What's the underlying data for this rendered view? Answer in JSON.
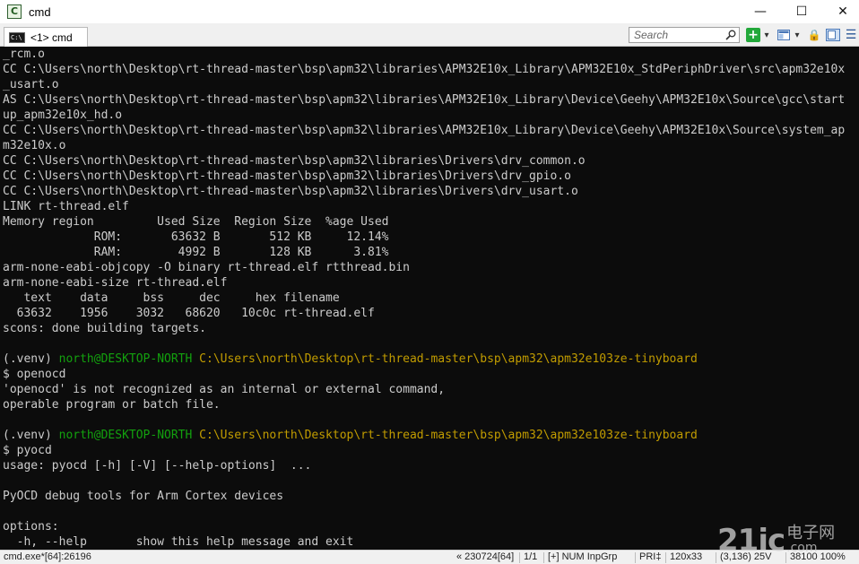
{
  "window": {
    "title": "cmd",
    "app_icon_glyph": "C",
    "minimize_glyph": "—",
    "maximize_glyph": "☐",
    "close_glyph": "✕"
  },
  "toolbar": {
    "tab_label": "<1>  cmd",
    "search_placeholder": "Search",
    "new_console_glyph": "+",
    "dropdown_glyph": "▾",
    "lock_glyph": "🔒",
    "menu_glyph": "☰"
  },
  "colors": {
    "console_bg": "#0c0c0c",
    "console_text": "#cccccc",
    "prompt_green": "#13a10e",
    "prompt_yellow": "#c19c00",
    "new_console_green": "#22a83a",
    "lock_yellow": "#d9a400"
  },
  "console": {
    "lines": [
      {
        "segments": [
          {
            "text": "_rcm.o",
            "color": "default"
          }
        ]
      },
      {
        "segments": [
          {
            "text": "CC C:\\Users\\north\\Desktop\\rt-thread-master\\bsp\\apm32\\libraries\\APM32E10x_Library\\APM32E10x_StdPeriphDriver\\src\\apm32e10x",
            "color": "default"
          }
        ]
      },
      {
        "segments": [
          {
            "text": "_usart.o",
            "color": "default"
          }
        ]
      },
      {
        "segments": [
          {
            "text": "AS C:\\Users\\north\\Desktop\\rt-thread-master\\bsp\\apm32\\libraries\\APM32E10x_Library\\Device\\Geehy\\APM32E10x\\Source\\gcc\\start",
            "color": "default"
          }
        ]
      },
      {
        "segments": [
          {
            "text": "up_apm32e10x_hd.o",
            "color": "default"
          }
        ]
      },
      {
        "segments": [
          {
            "text": "CC C:\\Users\\north\\Desktop\\rt-thread-master\\bsp\\apm32\\libraries\\APM32E10x_Library\\Device\\Geehy\\APM32E10x\\Source\\system_ap",
            "color": "default"
          }
        ]
      },
      {
        "segments": [
          {
            "text": "m32e10x.o",
            "color": "default"
          }
        ]
      },
      {
        "segments": [
          {
            "text": "CC C:\\Users\\north\\Desktop\\rt-thread-master\\bsp\\apm32\\libraries\\Drivers\\drv_common.o",
            "color": "default"
          }
        ]
      },
      {
        "segments": [
          {
            "text": "CC C:\\Users\\north\\Desktop\\rt-thread-master\\bsp\\apm32\\libraries\\Drivers\\drv_gpio.o",
            "color": "default"
          }
        ]
      },
      {
        "segments": [
          {
            "text": "CC C:\\Users\\north\\Desktop\\rt-thread-master\\bsp\\apm32\\libraries\\Drivers\\drv_usart.o",
            "color": "default"
          }
        ]
      },
      {
        "segments": [
          {
            "text": "LINK rt-thread.elf",
            "color": "default"
          }
        ]
      },
      {
        "segments": [
          {
            "text": "Memory region         Used Size  Region Size  %age Used",
            "color": "default"
          }
        ]
      },
      {
        "segments": [
          {
            "text": "             ROM:       63632 B       512 KB     12.14%",
            "color": "default"
          }
        ]
      },
      {
        "segments": [
          {
            "text": "             RAM:        4992 B       128 KB      3.81%",
            "color": "default"
          }
        ]
      },
      {
        "segments": [
          {
            "text": "arm-none-eabi-objcopy -O binary rt-thread.elf rtthread.bin",
            "color": "default"
          }
        ]
      },
      {
        "segments": [
          {
            "text": "arm-none-eabi-size rt-thread.elf",
            "color": "default"
          }
        ]
      },
      {
        "segments": [
          {
            "text": "   text    data     bss     dec     hex filename",
            "color": "default"
          }
        ]
      },
      {
        "segments": [
          {
            "text": "  63632    1956    3032   68620   10c0c rt-thread.elf",
            "color": "default"
          }
        ]
      },
      {
        "segments": [
          {
            "text": "scons: done building targets.",
            "color": "default"
          }
        ]
      },
      {
        "segments": [
          {
            "text": "",
            "color": "default"
          }
        ]
      },
      {
        "segments": [
          {
            "text": "(.venv) ",
            "color": "default"
          },
          {
            "text": "north@DESKTOP-NORTH",
            "color": "green"
          },
          {
            "text": " C:\\Users\\north\\Desktop\\rt-thread-master\\bsp\\apm32\\apm32e103ze-tinyboard",
            "color": "yellow"
          }
        ]
      },
      {
        "segments": [
          {
            "text": "$ openocd",
            "color": "default"
          }
        ]
      },
      {
        "segments": [
          {
            "text": "'openocd' is not recognized as an internal or external command,",
            "color": "default"
          }
        ]
      },
      {
        "segments": [
          {
            "text": "operable program or batch file.",
            "color": "default"
          }
        ]
      },
      {
        "segments": [
          {
            "text": "",
            "color": "default"
          }
        ]
      },
      {
        "segments": [
          {
            "text": "(.venv) ",
            "color": "default"
          },
          {
            "text": "north@DESKTOP-NORTH",
            "color": "green"
          },
          {
            "text": " C:\\Users\\north\\Desktop\\rt-thread-master\\bsp\\apm32\\apm32e103ze-tinyboard",
            "color": "yellow"
          }
        ]
      },
      {
        "segments": [
          {
            "text": "$ pyocd",
            "color": "default"
          }
        ]
      },
      {
        "segments": [
          {
            "text": "usage: pyocd [-h] [-V] [--help-options]  ...",
            "color": "default"
          }
        ]
      },
      {
        "segments": [
          {
            "text": "",
            "color": "default"
          }
        ]
      },
      {
        "segments": [
          {
            "text": "PyOCD debug tools for Arm Cortex devices",
            "color": "default"
          }
        ]
      },
      {
        "segments": [
          {
            "text": "",
            "color": "default"
          }
        ]
      },
      {
        "segments": [
          {
            "text": "options:",
            "color": "default"
          }
        ]
      },
      {
        "segments": [
          {
            "text": "  -h, --help       show this help message and exit",
            "color": "default"
          }
        ]
      }
    ]
  },
  "statusbar": {
    "process": "cmd.exe*[64]:26196",
    "build": "« 230724[64]",
    "page": "1/1",
    "flags": "[+] NUM InpGrp",
    "priority": "PRI‡",
    "size": "120x33",
    "cursor": "(3,136) 25V",
    "pid_zoom": "38100 100%"
  },
  "watermark": {
    "main": "21ic",
    "cn": "电子网",
    "en": ".com"
  }
}
